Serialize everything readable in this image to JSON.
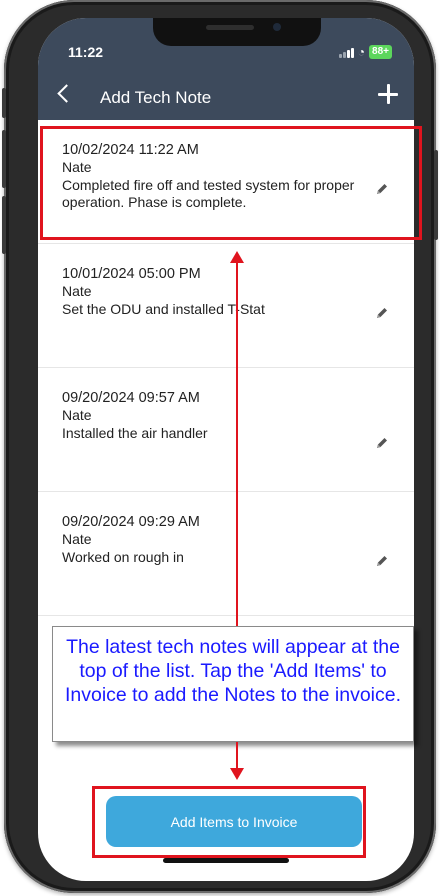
{
  "status_bar": {
    "time": "11:22",
    "battery": "88+"
  },
  "header": {
    "title": "Add Tech Note"
  },
  "notes": [
    {
      "datetime": "10/02/2024 11:22 AM",
      "author": "Nate",
      "text": "Completed fire off and tested system for proper operation. Phase is complete."
    },
    {
      "datetime": "10/01/2024 05:00 PM",
      "author": "Nate",
      "text": "Set the ODU and installed T-Stat"
    },
    {
      "datetime": "09/20/2024 09:57 AM",
      "author": "Nate",
      "text": "Installed the air handler"
    },
    {
      "datetime": "09/20/2024 09:29 AM",
      "author": "Nate",
      "text": "Worked on rough in"
    }
  ],
  "callout": {
    "text": "The latest tech notes will appear at the top of the list.  Tap the 'Add Items' to Invoice to add the Notes to the invoice."
  },
  "footer": {
    "add_button_label": "Add Items to Invoice"
  },
  "colors": {
    "header_bg": "#3d4a5c",
    "accent_button": "#3ea8dc",
    "annotation_red": "#e0141e",
    "callout_text": "#1a1aff"
  }
}
